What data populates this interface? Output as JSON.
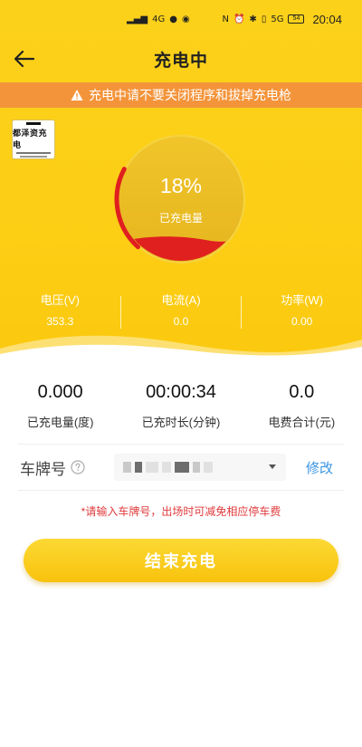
{
  "status_bar": {
    "network_label": "4G",
    "signal_label": "5G",
    "battery_label": "54",
    "time": "20:04"
  },
  "nav": {
    "back_icon": "arrow-left-icon",
    "title": "充电中"
  },
  "warning": {
    "icon": "warning-triangle-icon",
    "text": "充电中请不要关闭程序和拔掉充电枪"
  },
  "logo": {
    "name": "都泽资充电"
  },
  "charge": {
    "percent": 18,
    "percent_text": "18%",
    "label": "已充电量"
  },
  "live_stats": [
    {
      "label": "电压(V)",
      "value": "353.3"
    },
    {
      "label": "电流(A)",
      "value": "0.0"
    },
    {
      "label": "功率(W)",
      "value": "0.00"
    }
  ],
  "summary": [
    {
      "value": "0.000",
      "label": "已充电量(度)"
    },
    {
      "value": "00:00:34",
      "label": "已充时长(分钟)"
    },
    {
      "value": "0.0",
      "label": "电费合计(元)"
    }
  ],
  "plate": {
    "label": "车牌号",
    "help_icon": "question-circle-icon",
    "caret_icon": "caret-down-icon",
    "edit_label": "修改"
  },
  "hint": "*请输入车牌号，出场时可减免相应停车费",
  "end_button_label": "结束充电",
  "colors": {
    "brand_yellow": "#fcd11a",
    "warning_orange": "#f4943a",
    "gauge_red": "#e01f1f",
    "link_blue": "#3a95e4",
    "hint_red": "#e0393b"
  }
}
